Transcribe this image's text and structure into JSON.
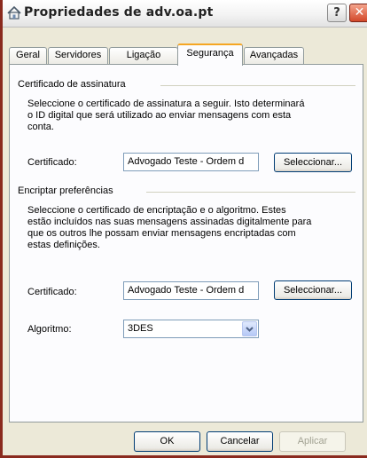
{
  "window": {
    "title": "Propriedades de adv.oa.pt",
    "help_glyph": "?",
    "close_glyph": "✕"
  },
  "tabs": [
    {
      "label": "Geral"
    },
    {
      "label": "Servidores"
    },
    {
      "label": "Ligação"
    },
    {
      "label": "Segurança",
      "active": true
    },
    {
      "label": "Avançadas"
    }
  ],
  "signing": {
    "group_label": "Certificado de assinatura",
    "description_lines": [
      "Seleccione o certificado de assinatura a seguir. Isto determinará",
      "o ID digital que será utilizado ao enviar mensagens com esta",
      "conta."
    ],
    "certificate_label": "Certificado:",
    "certificate_value": "Advogado Teste - Ordem d",
    "select_button": "Seleccionar..."
  },
  "encryption": {
    "group_label": "Encriptar preferências",
    "description_lines": [
      "Seleccione o certificado de encriptação e o algoritmo. Estes",
      "estão incluídos nas suas mensagens assinadas digitalmente para",
      "que os outros lhe possam enviar mensagens encriptadas com",
      "estas definições."
    ],
    "certificate_label": "Certificado:",
    "certificate_value": "Advogado Teste - Ordem d",
    "select_button": "Seleccionar...",
    "algorithm_label": "Algoritmo:",
    "algorithm_value": "3DES"
  },
  "footer": {
    "ok": "OK",
    "cancel": "Cancelar",
    "apply": "Aplicar"
  }
}
